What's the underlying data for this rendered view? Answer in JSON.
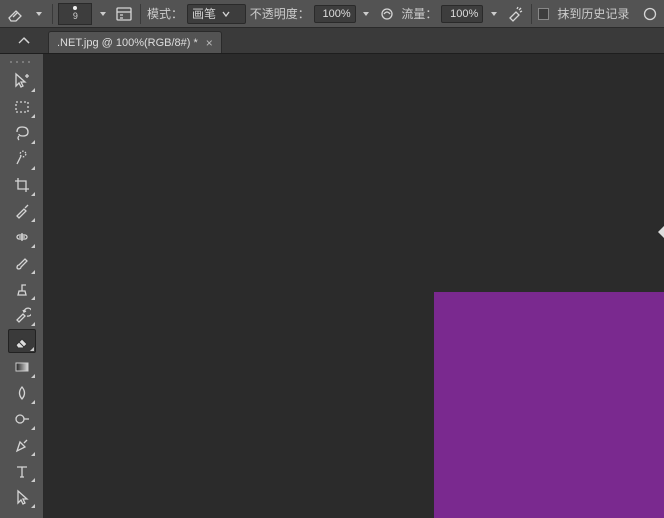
{
  "options": {
    "brush_tip_size": "9",
    "mode_label": "模式：",
    "mode_value": "画笔",
    "opacity_label": "不透明度：",
    "opacity_value": "100%",
    "flow_label": "流量：",
    "flow_value": "100%",
    "erase_history_label": "抹到历史记录"
  },
  "document": {
    "tab_title": ".NET.jpg @ 100%(RGB/8#) *"
  },
  "canvas": {
    "object_fill": "#7a298f"
  },
  "tools": [
    {
      "id": "move",
      "name": "move-tool"
    },
    {
      "id": "marquee",
      "name": "rectangular-marquee-tool"
    },
    {
      "id": "lasso",
      "name": "lasso-tool"
    },
    {
      "id": "wand",
      "name": "quick-selection-tool"
    },
    {
      "id": "crop",
      "name": "crop-tool"
    },
    {
      "id": "eyedrop",
      "name": "eyedropper-tool"
    },
    {
      "id": "heal",
      "name": "healing-brush-tool"
    },
    {
      "id": "brush",
      "name": "brush-tool"
    },
    {
      "id": "stamp",
      "name": "clone-stamp-tool"
    },
    {
      "id": "history",
      "name": "history-brush-tool"
    },
    {
      "id": "eraser",
      "name": "eraser-tool",
      "active": true
    },
    {
      "id": "gradient",
      "name": "gradient-tool"
    },
    {
      "id": "blur",
      "name": "blur-tool"
    },
    {
      "id": "dodge",
      "name": "dodge-tool"
    },
    {
      "id": "pen",
      "name": "pen-tool"
    },
    {
      "id": "type",
      "name": "type-tool"
    },
    {
      "id": "path",
      "name": "path-selection-tool"
    }
  ]
}
